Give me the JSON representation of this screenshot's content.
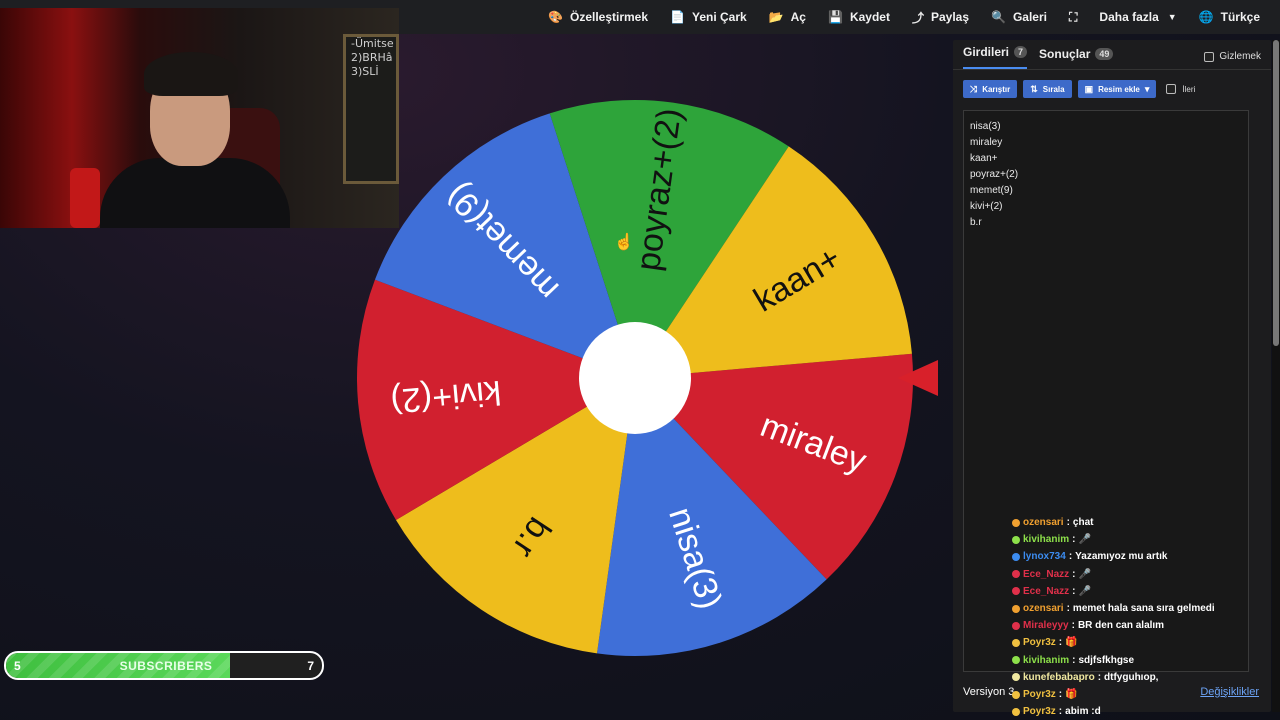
{
  "topbar": {
    "items": [
      {
        "label": "Özelleştirmek",
        "icon": "palette-icon",
        "glyph": "🎨"
      },
      {
        "label": "Yeni Çark",
        "icon": "file-icon",
        "glyph": "📄"
      },
      {
        "label": "Aç",
        "icon": "folder-icon",
        "glyph": "📂"
      },
      {
        "label": "Kaydet",
        "icon": "save-icon",
        "glyph": "💾"
      },
      {
        "label": "Paylaş",
        "icon": "share-icon",
        "glyph": "⤴"
      },
      {
        "label": "Galeri",
        "icon": "search-icon",
        "glyph": "🔍"
      },
      {
        "label": "",
        "icon": "fullscreen-icon",
        "glyph": "⛶"
      },
      {
        "label": "Daha fazla",
        "icon": "",
        "glyph": ""
      },
      {
        "label": "Türkçe",
        "icon": "globe-icon",
        "glyph": "🌐"
      }
    ]
  },
  "webcam": {
    "board_lines": [
      "-Ümitse",
      "2)BRHâ",
      "3)SLİ"
    ]
  },
  "wheel": {
    "segments": [
      {
        "label": "miraley",
        "color": "#d1202f"
      },
      {
        "label": "nisa(3)",
        "color": "#3f6fd8"
      },
      {
        "label": "b.r",
        "color": "#eebd1c"
      },
      {
        "label": "kivi+(2)",
        "color": "#d1202f"
      },
      {
        "label": "memet(9)",
        "color": "#3f6fd8"
      },
      {
        "label": "poyraz+(2)",
        "color": "#2ea43a"
      },
      {
        "label": "kaan+",
        "color": "#eebd1c"
      }
    ]
  },
  "panel": {
    "tab_entries": "Girdileri",
    "tab_entries_count": "7",
    "tab_results": "Sonuçlar",
    "tab_results_count": "49",
    "hide_label": "Gizlemek",
    "shuffle_label": "Karıştır",
    "sort_label": "Sırala",
    "add_image_label": "Resim ekle",
    "advanced_label": "İleri",
    "entries": [
      "nisa(3)",
      "miraley",
      "kaan+",
      "poyraz+(2)",
      "memet(9)",
      "kivi+(2)",
      "b.r"
    ],
    "version_label": "Versiyon 3",
    "changes_label": "Değişiklikler"
  },
  "chat": [
    {
      "user": "ozensari",
      "color": "#f0a030",
      "msg": "çhat"
    },
    {
      "user": "kivihanim",
      "color": "#8de04a",
      "msg": "🎤"
    },
    {
      "user": "lynox734",
      "color": "#3c8cf0",
      "msg": "Yazamıyoz mu artık"
    },
    {
      "user": "Ece_Nazz",
      "color": "#e0304a",
      "msg": "🎤"
    },
    {
      "user": "Ece_Nazz",
      "color": "#e0304a",
      "msg": "🎤"
    },
    {
      "user": "ozensari",
      "color": "#f0a030",
      "msg": "memet hala sana sıra gelmedi"
    },
    {
      "user": "Miraleyyy",
      "color": "#e0304a",
      "msg": "BR den can alalım"
    },
    {
      "user": "Poyr3z",
      "color": "#f0c040",
      "msg": "🎁"
    },
    {
      "user": "kivihanim",
      "color": "#8de04a",
      "msg": "sdjfsfkhgse"
    },
    {
      "user": "kunefebabapro",
      "color": "#f0e8a0",
      "msg": "dtfyguhıop,"
    },
    {
      "user": "Poyr3z",
      "color": "#f0c040",
      "msg": "🎁"
    },
    {
      "user": "Poyr3z",
      "color": "#f0c040",
      "msg": "abim :d"
    }
  ],
  "subscribers": {
    "current": "5",
    "label": "SUBSCRIBERS",
    "goal": "7",
    "progress": 0.71
  }
}
